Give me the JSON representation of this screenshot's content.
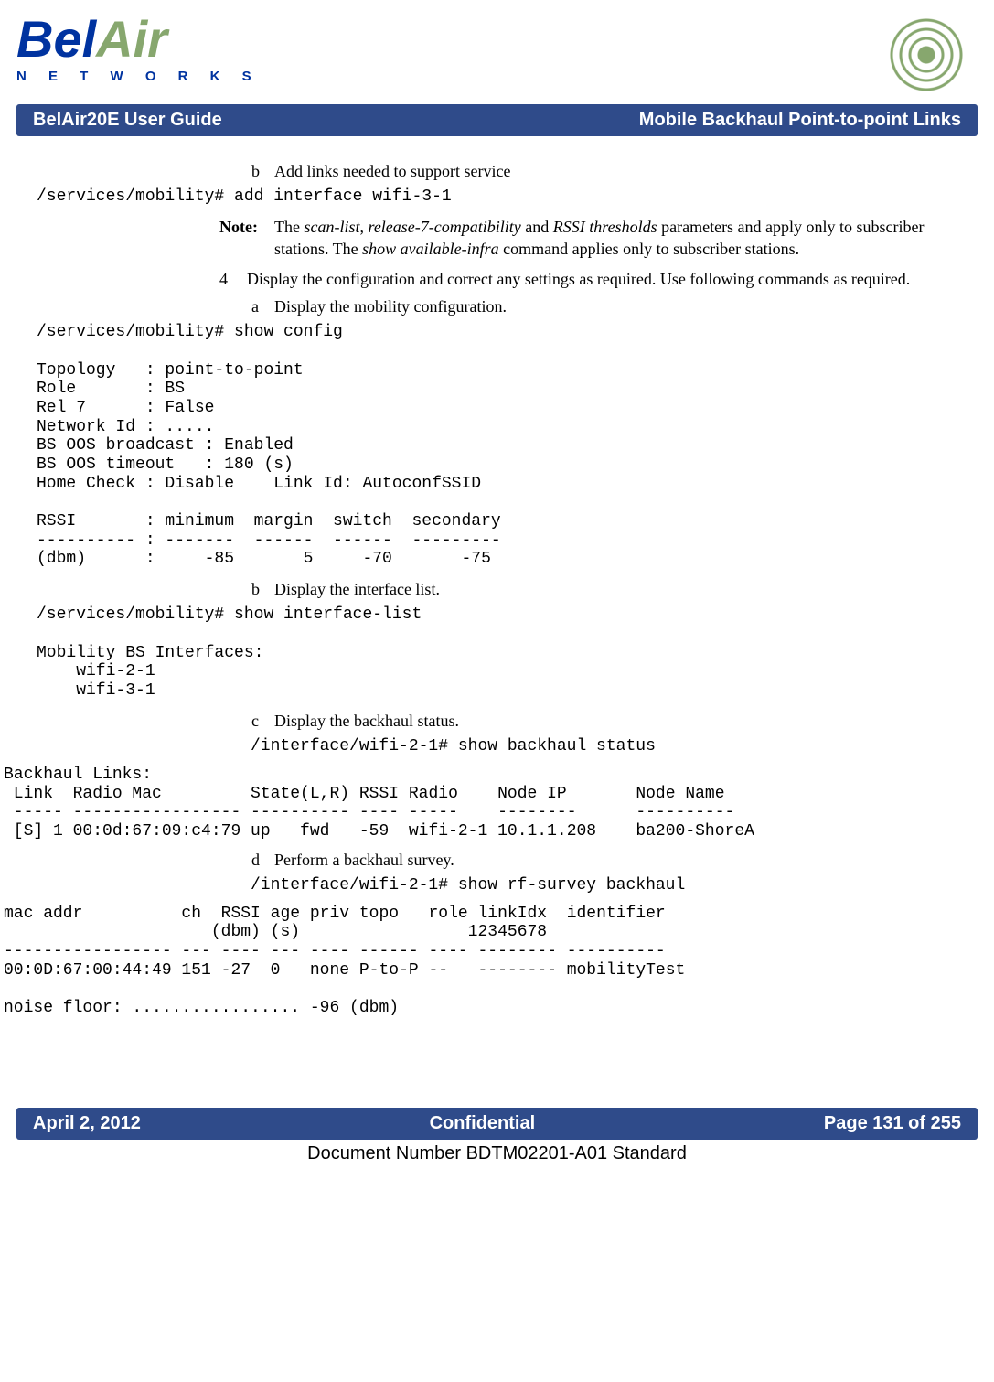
{
  "header": {
    "logo_brand": "BelAir",
    "logo_sub": "N E T W O R K S",
    "guide_title": "BelAir20E User Guide",
    "section_title": "Mobile Backhaul Point-to-point Links"
  },
  "body": {
    "step_b_label": "b",
    "step_b_text": "Add links needed to support service",
    "step_b_cmd": "/services/mobility# add interface wifi-3-1",
    "note_label": "Note:",
    "note_pre": "The ",
    "note_i1": "scan-list",
    "note_mid1": ", ",
    "note_i2": "release-7-compatibility",
    "note_mid2": " and ",
    "note_i3": "RSSI thresholds",
    "note_post1": " parameters and apply only to subscriber stations. The ",
    "note_i4": "show available-infra",
    "note_post2": " command applies only to subscriber stations.",
    "step4_num": "4",
    "step4_text": "Display the configuration and correct any settings as required. Use following commands as required.",
    "step4a_label": "a",
    "step4a_text": "Display the mobility configuration.",
    "step4a_cmd": "/services/mobility# show config\n\nTopology   : point-to-point\nRole       : BS\nRel 7      : False\nNetwork Id : .....\nBS OOS broadcast : Enabled\nBS OOS timeout   : 180 (s)\nHome Check : Disable    Link Id: AutoconfSSID\n\nRSSI       : minimum  margin  switch  secondary\n---------- : -------  ------  ------  ---------\n(dbm)      :     -85       5     -70       -75",
    "step4b_label": "b",
    "step4b_text": "Display the interface list.",
    "step4b_cmd": "/services/mobility# show interface-list\n\nMobility BS Interfaces:\n    wifi-2-1\n    wifi-3-1",
    "step4c_label": "c",
    "step4c_text": "Display the backhaul status.",
    "step4c_cmd": "/interface/wifi-2-1# show backhaul status",
    "backhaul_block": "Backhaul Links:\n Link  Radio Mac         State(L,R) RSSI Radio    Node IP       Node Name\n ----- ----------------- ---------- ---- -----    --------      ----------\n [S] 1 00:0d:67:09:c4:79 up   fwd   -59  wifi-2-1 10.1.1.208    ba200-ShoreA",
    "step4d_label": "d",
    "step4d_text": "Perform a backhaul survey.",
    "step4d_cmd": "/interface/wifi-2-1# show rf-survey backhaul",
    "survey_block": "mac addr          ch  RSSI age priv topo   role linkIdx  identifier\n                     (dbm) (s)                 12345678\n----------------- --- ---- --- ---- ------ ---- -------- ----------\n00:0D:67:00:44:49 151 -27  0   none P-to-P --   -------- mobilityTest\n\nnoise floor: ................. -96 (dbm)"
  },
  "footer": {
    "date": "April 2, 2012",
    "confidential": "Confidential",
    "page": "Page 131 of 255",
    "docnum": "Document Number BDTM02201-A01 Standard"
  }
}
